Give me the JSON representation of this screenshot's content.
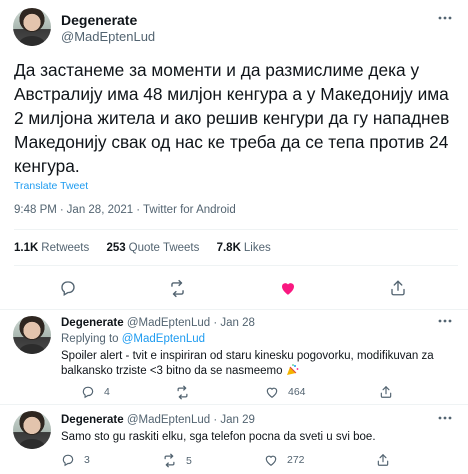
{
  "main_tweet": {
    "display_name": "Degenerate",
    "handle": "@MadEptenLud",
    "more_icon": "more-horizontal-icon",
    "text": "Да застанеме за моменти и да размислиме дека у Австралију има 48 милјон кенгура а у Македонију има 2 милјона житела и ако решив кенгури да гу нападнев Македонију свак од нас ке треба да се тепа против 24 кенгура.",
    "translate_label": "Translate Tweet",
    "time": "9:48 PM",
    "date": "Jan 28, 2021",
    "source": "Twitter for Android",
    "dot": "·",
    "stats": {
      "retweets_count": "1.1K",
      "retweets_label": "Retweets",
      "quotes_count": "253",
      "quotes_label": "Quote Tweets",
      "likes_count": "7.8K",
      "likes_label": "Likes"
    },
    "actions": [
      "reply-icon",
      "retweet-icon",
      "like-icon-filled",
      "share-icon"
    ],
    "colors": {
      "like": "#f91880",
      "link": "#1d9bf0",
      "muted": "#536471"
    }
  },
  "replies": [
    {
      "display_name": "Degenerate",
      "handle": "@MadEptenLud",
      "dot": "·",
      "date": "Jan 28",
      "replying_label": "Replying to",
      "replying_to": "@MadEptenLud",
      "text": "Spoiler alert - tvit e inspiriran od staru kinesku pogovorku, modifikuvan za balkansko trziste <3 bitno da se nasmeemo",
      "emoji": "party-popper-emoji",
      "reply_count": "4",
      "retweet_count": "",
      "like_count": "464"
    },
    {
      "display_name": "Degenerate",
      "handle": "@MadEptenLud",
      "dot": "·",
      "date": "Jan 29",
      "text": "Samo sto gu raskiti elku, sga telefon pocna da sveti u svi boe.",
      "reply_count": "3",
      "retweet_count": "5",
      "like_count": "272"
    }
  ]
}
